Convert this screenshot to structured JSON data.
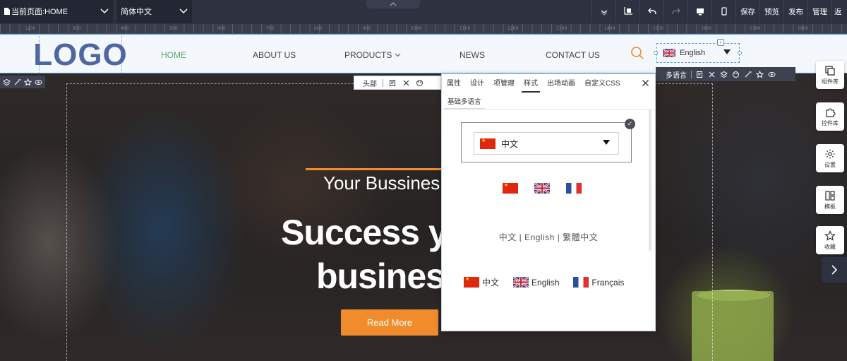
{
  "topbar": {
    "page_select": "当前页面:HOME",
    "lang_select": "简体中文",
    "buttons": {
      "save": "保存",
      "preview": "预览",
      "publish": "发布",
      "manage": "管理",
      "more": "返"
    }
  },
  "ruler": {
    "ticks": [
      "1200",
      "600",
      "400",
      "500",
      "600",
      "700",
      "800",
      "900",
      "1000",
      "1100",
      "1200",
      "1300",
      "1400",
      "1500",
      "1600",
      "1700",
      "1800"
    ]
  },
  "site": {
    "logo": "LOGO",
    "nav": [
      "HOME",
      "ABOUT US",
      "PRODUCTS",
      "NEWS",
      "CONTACT US"
    ],
    "lang_current": "English"
  },
  "hero": {
    "subtitle": "Your Bussines",
    "title_line1": "Success y",
    "title_line2": "busines",
    "cta": "Read More"
  },
  "toolbars": {
    "head_label": "头部",
    "multilang_label": "多语言"
  },
  "panel": {
    "tabs": [
      "属性",
      "设计",
      "项管理",
      "样式",
      "出场动画",
      "自定义CSS"
    ],
    "active_tab": "样式",
    "subtab": "基础多语言",
    "style1_value": "中文",
    "style3_text": "中文 | English | 繁體中文",
    "style4_items": [
      "中文",
      "English",
      "Français"
    ]
  },
  "sidebar": {
    "component_lib": "组件库",
    "widget_lib": "控件库",
    "settings": "设置",
    "templates": "模板",
    "favorites": "收藏"
  }
}
